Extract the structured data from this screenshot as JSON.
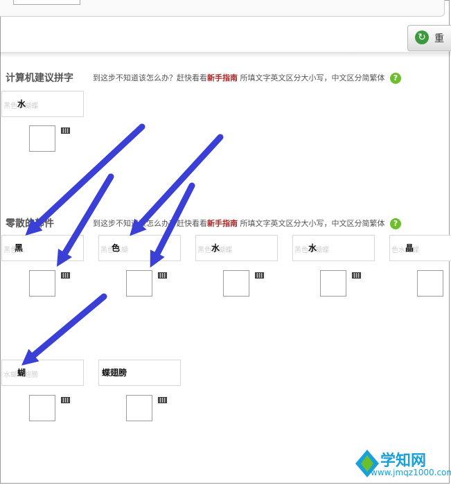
{
  "toolbar": {
    "reset_label": "重"
  },
  "section1": {
    "title": "计算机建议拼字",
    "hint_pre": "到这步不知道该怎么办？赶快看看",
    "hint_link": "新手指南",
    "hint_post": "所填文字英文区分大小写，中文区分简繁体",
    "help": "?",
    "parts": [
      {
        "ghost": "黑色水蝴蝶",
        "big": "水"
      }
    ]
  },
  "section2": {
    "title": "零散的部件",
    "hint_pre": "到这步不知道该怎么办？赶快看看",
    "hint_link": "新手指南",
    "hint_post": "所填文字英文区分大小写，中文区分简繁体",
    "help": "?",
    "parts": [
      {
        "ghost": "黑色水",
        "big": "黑"
      },
      {
        "ghost": "黑色水蝴",
        "big": "色"
      },
      {
        "ghost": "黑色水蝴蝶",
        "big": "水"
      },
      {
        "ghost": "黑色水蝴蝶",
        "big": "水"
      },
      {
        "ghost": "色水蝴蝶",
        "big": "晶"
      },
      {
        "ghost": "水蝴蝶翅膀",
        "big": "蝴"
      },
      {
        "ghost": "",
        "big": "蝶翅膀"
      }
    ]
  },
  "watermark": {
    "brand": "学知网",
    "url": "www.jmqz1000.com"
  },
  "colors": {
    "arrow": "#3a3fd6",
    "accent_red": "#b22222",
    "help_green": "#6cbf2c"
  }
}
